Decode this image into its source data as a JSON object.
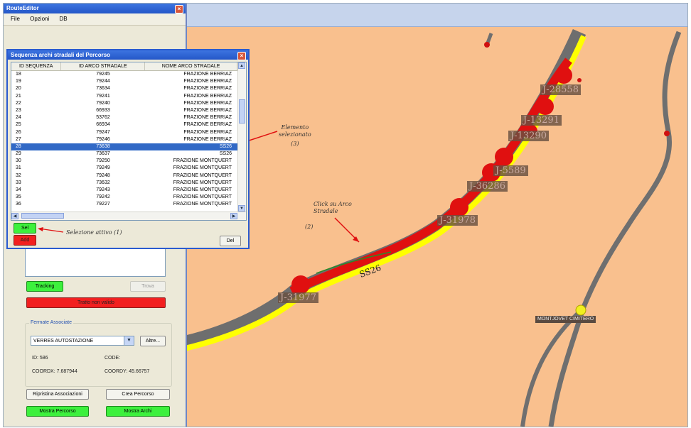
{
  "editor": {
    "title": "RouteEditor",
    "menu": [
      "File",
      "Opzioni",
      "DB"
    ],
    "tracking_label": "Tracking",
    "trova_label": "Trova",
    "tratto_label": "Tratto non valido",
    "group_label": "Fermate Associate",
    "select_value": "VERRES AUTOSTAZIONE",
    "altre_label": "Altre...",
    "id_text": "ID: 586",
    "code_text": "CODE:",
    "coordx_text": "COORDX: 7.687944",
    "coordy_text": "COORDY: 45.66757",
    "ripristina_label": "Ripristina Associazioni",
    "crea_label": "Crea Percorso",
    "mostra_percorso_label": "Mostra Percorso",
    "mostra_archi_label": "Mostra Archi"
  },
  "dialog": {
    "title": "Sequenza archi stradali del Percorso",
    "headers": [
      "ID SEQUENZA",
      "ID ARCO STRADALE",
      "NOME ARCO STRADALE"
    ],
    "rows": [
      [
        "18",
        "79245",
        "FRAZIONE BERRIAZ"
      ],
      [
        "19",
        "79244",
        "FRAZIONE BERRIAZ"
      ],
      [
        "20",
        "73634",
        "FRAZIONE BERRIAZ"
      ],
      [
        "21",
        "79241",
        "FRAZIONE BERRIAZ"
      ],
      [
        "22",
        "79240",
        "FRAZIONE BERRIAZ"
      ],
      [
        "23",
        "66933",
        "FRAZIONE BERRIAZ"
      ],
      [
        "24",
        "53762",
        "FRAZIONE BERRIAZ"
      ],
      [
        "25",
        "66934",
        "FRAZIONE BERRIAZ"
      ],
      [
        "26",
        "79247",
        "FRAZIONE BERRIAZ"
      ],
      [
        "27",
        "79246",
        "FRAZIONE BERRIAZ"
      ],
      [
        "28",
        "73638",
        "SS26"
      ],
      [
        "29",
        "73637",
        "SS26"
      ],
      [
        "30",
        "79250",
        "FRAZIONE MONTQUERT"
      ],
      [
        "31",
        "79249",
        "FRAZIONE MONTQUERT"
      ],
      [
        "32",
        "79248",
        "FRAZIONE MONTQUERT"
      ],
      [
        "33",
        "73632",
        "FRAZIONE MONTQUERT"
      ],
      [
        "34",
        "79243",
        "FRAZIONE MONTQUERT"
      ],
      [
        "35",
        "79242",
        "FRAZIONE MONTQUERT"
      ],
      [
        "36",
        "79227",
        "FRAZIONE MONTQUERT"
      ]
    ],
    "selected_index": 10,
    "sel_label": "Sel",
    "add_label": "Add",
    "del_label": "Del"
  },
  "annotations": {
    "elemento": [
      "Elemento",
      "selezionato",
      "(3)"
    ],
    "click": [
      "Click su Arco",
      "Stradale"
    ],
    "click_num": "(2)",
    "selezione": "Selezione attivo  (1)"
  },
  "map": {
    "road_name": "SS26",
    "stop_label": "MONTJOVET CIMITERO",
    "junctions": [
      "J-28558",
      "J-13291",
      "J-13290",
      "J-5589",
      "J-36286",
      "J-31978",
      "J-31977"
    ]
  },
  "colors": {
    "map_bg": "#f9c08e",
    "route_red": "#e01010",
    "road_yellow": "#ffff00",
    "road_gray": "#707070",
    "selected_row": "#3169c6",
    "button_green": "#3df03d",
    "button_red": "#f21f1f"
  }
}
